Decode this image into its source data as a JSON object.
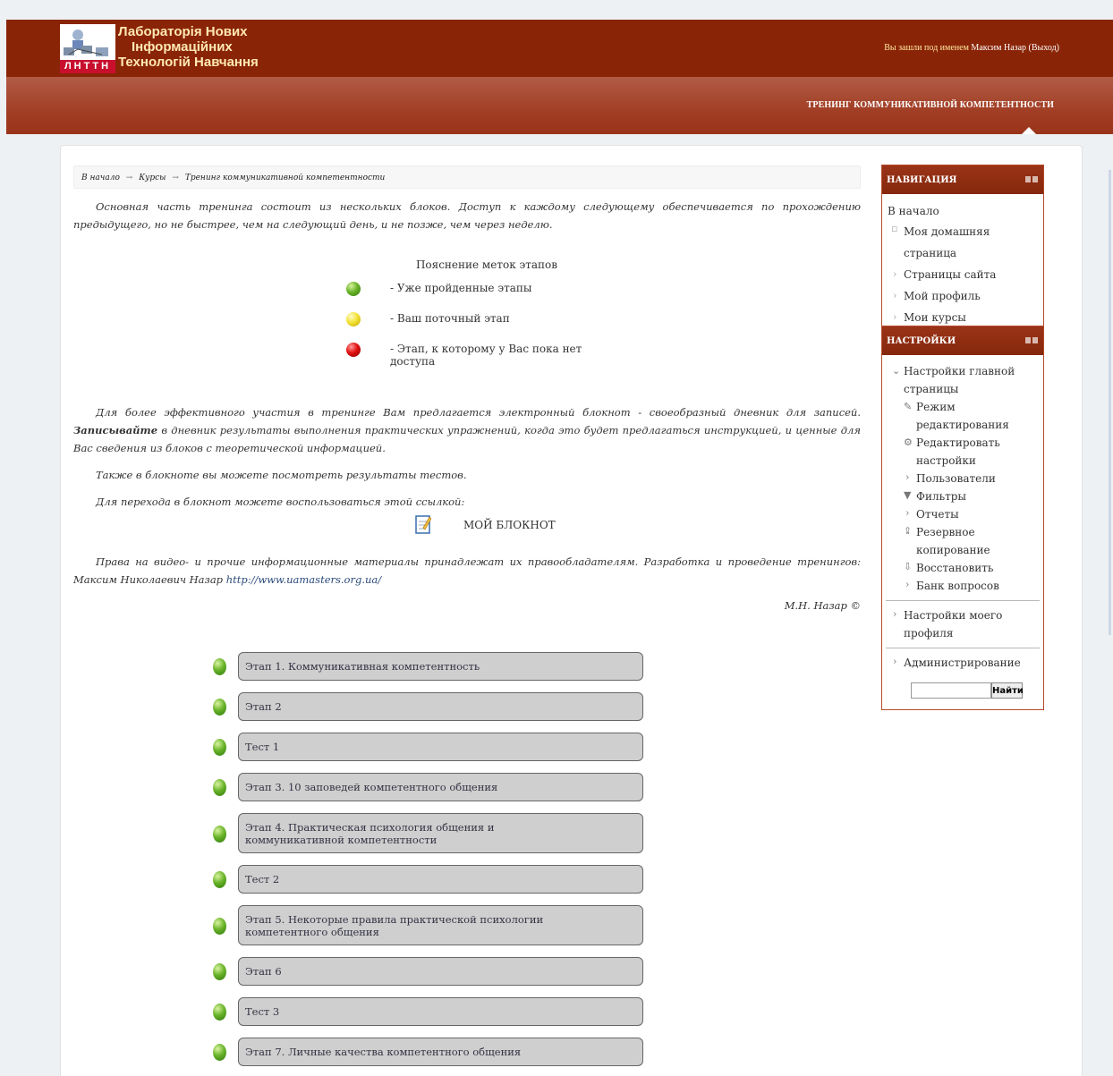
{
  "header": {
    "logo_lines": [
      "Лабораторія Нових",
      "Інформаційних",
      "Технологій Навчання"
    ],
    "logo_mark_letters": "ЛНТТН",
    "login_prefix": "Вы зашли под именем",
    "user_name": "Максим Назар",
    "logout_label": "(Выход)"
  },
  "course_tab": "ТРЕНИНГ КОММУНИКАТИВНОЙ КОМПЕТЕНТНОСТИ",
  "breadcrumb": {
    "home": "В начало",
    "courses": "Курсы",
    "current": "Тренинг коммуникативной компетентности",
    "separator": "→"
  },
  "intro": "Основная часть тренинга состоит из нескольких блоков. Доступ к каждому следующему обеспечивается по прохождению предыдущего, но не быстрее, чем на следующий день, и не позже, чем через неделю.",
  "legend": {
    "title": "Пояснение меток этапов",
    "items": [
      {
        "color": "green",
        "label": "- Уже пройденные этапы"
      },
      {
        "color": "yellow",
        "label": "- Ваш поточный этап"
      },
      {
        "color": "red",
        "label": "- Этап, к которому у Вас пока нет доступа"
      }
    ]
  },
  "paragraph1_a": "Для более эффективного участия в тренинге Вам предлагается электронный блокнот - своеобразный дневник для записей. ",
  "paragraph1_bold": "Записывайте",
  "paragraph1_b": " в дневник результаты выполнения практических упражнений, когда это будет предлагаться инструкцией, и ценные для Вас сведения из блоков с теоретической информацией.",
  "paragraph2": "Также в блокноте вы можете посмотреть результаты тестов.",
  "paragraph3": "Для перехода в блокнот можете воспользоваться этой ссылкой:",
  "notebook_link": "МОЙ БЛОКНОТ",
  "rights_text": "Права на видео- и прочие информационные материалы принадлежат их правообладателям. Разработка и проведение тренингов: Максим Николаевич Назар ",
  "rights_url": "http://www.uamasters.org.ua/",
  "author": "М.Н. Назар ©",
  "stages": [
    {
      "label": "Этап 1. Коммуникативная компетентность",
      "status": "green"
    },
    {
      "label": "Этап 2",
      "status": "green"
    },
    {
      "label": "Тест 1",
      "status": "green"
    },
    {
      "label": "Этап 3. 10 заповедей компетентного общения",
      "status": "green"
    },
    {
      "label": "Этап 4. Практическая психология общения и коммуникативной компетентности",
      "status": "green"
    },
    {
      "label": "Тест 2",
      "status": "green"
    },
    {
      "label": "Этап 5. Некоторые правила практической психологии компетентного общения",
      "status": "green"
    },
    {
      "label": "Этап 6",
      "status": "green"
    },
    {
      "label": "Тест 3",
      "status": "green"
    },
    {
      "label": "Этап 7. Личные качества компетентного общения",
      "status": "green"
    }
  ],
  "navigation": {
    "title": "НАВИГАЦИЯ",
    "home": "В начало",
    "items": [
      "Моя домашняя страница",
      "Страницы сайта",
      "Мой профиль",
      "Мои курсы"
    ]
  },
  "settings": {
    "title": "НАСТРОЙКИ",
    "main_page_settings": "Настройки главной страницы",
    "edit_mode": "Режим редактирования",
    "edit_settings": "Редактировать настройки",
    "users": "Пользователи",
    "filters": "Фильтры",
    "reports": "Отчеты",
    "backup": "Резервное копирование",
    "restore": "Восстановить",
    "question_bank": "Банк вопросов",
    "profile_settings": "Настройки моего профиля",
    "administration": "Администрирование",
    "search_button": "Найти"
  },
  "colors": {
    "header_bg": "#8a2407",
    "band_bg": "#a13e25",
    "stage_box": "#cfcfcf",
    "status_green": "#4a9a1a",
    "status_yellow": "#f2e337",
    "status_red": "#e01010"
  }
}
